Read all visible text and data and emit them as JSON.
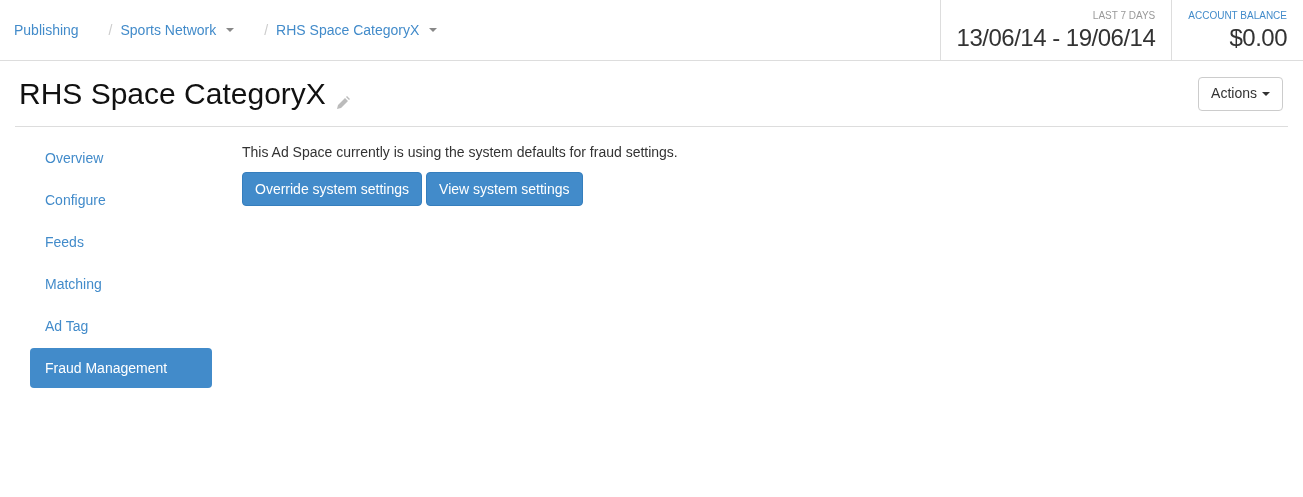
{
  "breadcrumb": [
    {
      "label": "Publishing",
      "has_menu": false
    },
    {
      "separator": "/",
      "label": "Sports Network",
      "has_menu": true
    },
    {
      "separator": "/",
      "label": "RHS Space CategoryX",
      "has_menu": true
    }
  ],
  "stats": [
    {
      "kind": "range",
      "label": "LAST 7 DAYS",
      "value": "13/06/14 - 19/06/14"
    },
    {
      "kind": "balance",
      "label": "ACCOUNT BALANCE",
      "value": "$0.00"
    }
  ],
  "page_title": "RHS Space CategoryX",
  "actions_button": "Actions",
  "sidebar": {
    "items": [
      {
        "label": "Overview",
        "selected": false
      },
      {
        "label": "Configure",
        "selected": false
      },
      {
        "label": "Feeds",
        "selected": false
      },
      {
        "label": "Matching",
        "selected": false
      },
      {
        "label": "Ad Tag",
        "selected": false
      },
      {
        "label": "Fraud Management",
        "selected": true
      }
    ]
  },
  "message": "This Ad Space currently is using the system defaults for fraud settings.",
  "buttons": [
    "Override system settings",
    "View system settings"
  ]
}
